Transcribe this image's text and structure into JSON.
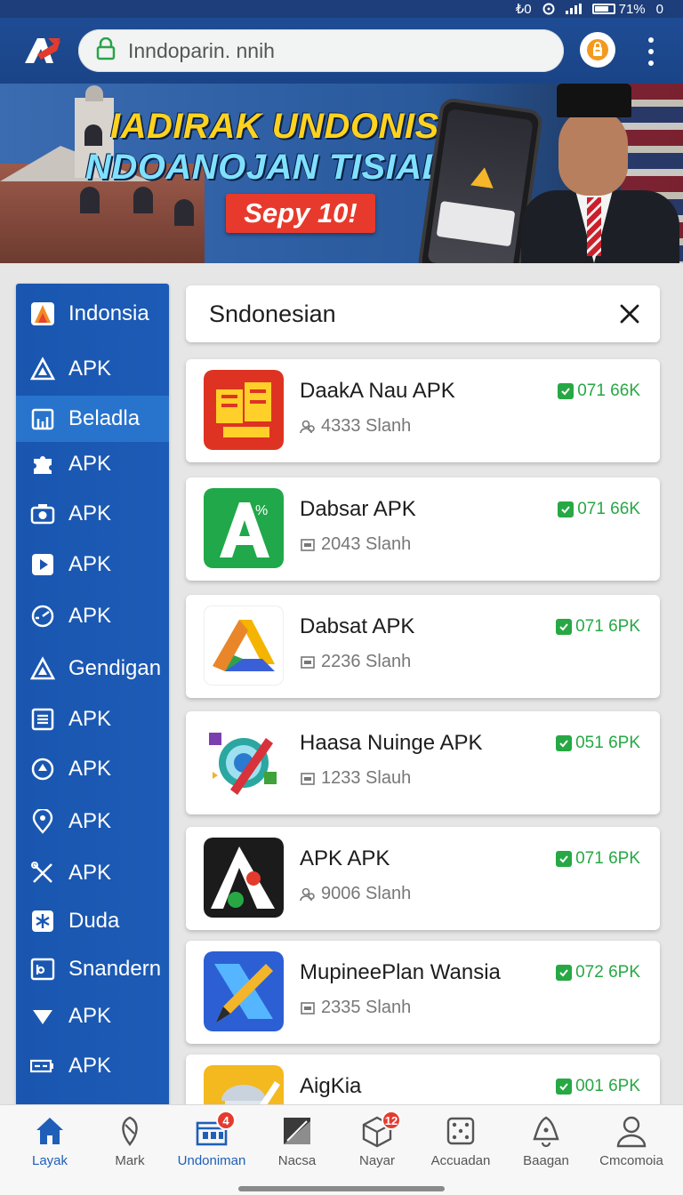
{
  "status_bar": {
    "left_text": "₺0",
    "battery": "71%",
    "right_text": "0"
  },
  "browser": {
    "url": "Inndoparin. nnih",
    "logo": "red-blue-a-logo",
    "extension_icon": "shopping-bag-icon",
    "menu_icon": "more-vertical-icon"
  },
  "banner": {
    "title1": "IADIRAK UNDONISII",
    "title2": "NDOANOJAN TISIALS",
    "cta": "Sepy 10!"
  },
  "sidebar": {
    "items": [
      {
        "label": "Indonsia",
        "icon": "brand-a-icon"
      },
      {
        "label": "APK",
        "icon": "triangle-icon"
      },
      {
        "label": "Beladla",
        "icon": "store-icon"
      },
      {
        "label": "APK",
        "icon": "puzzle-icon"
      },
      {
        "label": "APK",
        "icon": "camera-icon"
      },
      {
        "label": "APK",
        "icon": "play-icon"
      },
      {
        "label": "APK",
        "icon": "speed-icon"
      },
      {
        "label": "Gendigan",
        "icon": "triangle-icon"
      },
      {
        "label": "APK",
        "icon": "document-icon"
      },
      {
        "label": "APK",
        "icon": "target-icon"
      },
      {
        "label": "APK",
        "icon": "map-pin-icon"
      },
      {
        "label": "APK",
        "icon": "tools-icon"
      },
      {
        "label": "Duda",
        "icon": "snowflake-icon"
      },
      {
        "label": "Snandern",
        "icon": "calendar-icon"
      },
      {
        "label": "APK",
        "icon": "dropdown-triangle-icon"
      },
      {
        "label": "APK",
        "icon": "battery-icon"
      }
    ]
  },
  "search": {
    "value": "Sndonesian",
    "clear_icon": "close-icon"
  },
  "apps": [
    {
      "name": "DaakA Nau APK",
      "meta": "4333 Slanh",
      "meta_icon": "users-icon",
      "size": "071 66K",
      "icon": "red-tiles-icon"
    },
    {
      "name": "Dabsar APK",
      "meta": "2043 Slanh",
      "meta_icon": "box-icon",
      "size": "071 66K",
      "icon": "green-a-icon"
    },
    {
      "name": "Dabsat APK",
      "meta": "2236 Slanh",
      "meta_icon": "box-icon",
      "size": "071 6PK",
      "icon": "drive-triangle-icon"
    },
    {
      "name": "Haasa Nuinge APK",
      "meta": "1233 Slauh",
      "meta_icon": "box-icon",
      "size": "051 6PK",
      "icon": "target-pencil-icon"
    },
    {
      "name": "APK APK",
      "meta": "9006 Slanh",
      "meta_icon": "users-icon",
      "size": "071 6PK",
      "icon": "black-a-icon"
    },
    {
      "name": "MupineePlan Wansia",
      "meta": "2335 Slanh",
      "meta_icon": "box-icon",
      "size": "072 6PK",
      "icon": "blue-pen-icon"
    },
    {
      "name": "AigKia",
      "meta": "",
      "meta_icon": "box-icon",
      "size": "001 6PK",
      "icon": "yellow-building-icon"
    }
  ],
  "nav": {
    "items": [
      {
        "label": "Layak",
        "icon": "home-icon",
        "badge": ""
      },
      {
        "label": "Mark",
        "icon": "tag-icon",
        "badge": ""
      },
      {
        "label": "Undoniman",
        "icon": "shop-icon",
        "badge": "4"
      },
      {
        "label": "Nacsa",
        "icon": "image-icon",
        "badge": ""
      },
      {
        "label": "Nayar",
        "icon": "package-icon",
        "badge": "12"
      },
      {
        "label": "Accuadan",
        "icon": "dice-icon",
        "badge": ""
      },
      {
        "label": "Baagan",
        "icon": "alert-bell-icon",
        "badge": ""
      },
      {
        "label": "Cmcomoia",
        "icon": "user-icon",
        "badge": ""
      }
    ]
  },
  "colors": {
    "primary": "#1a56b0",
    "accent_green": "#27a844",
    "badge_red": "#e53b2f"
  }
}
